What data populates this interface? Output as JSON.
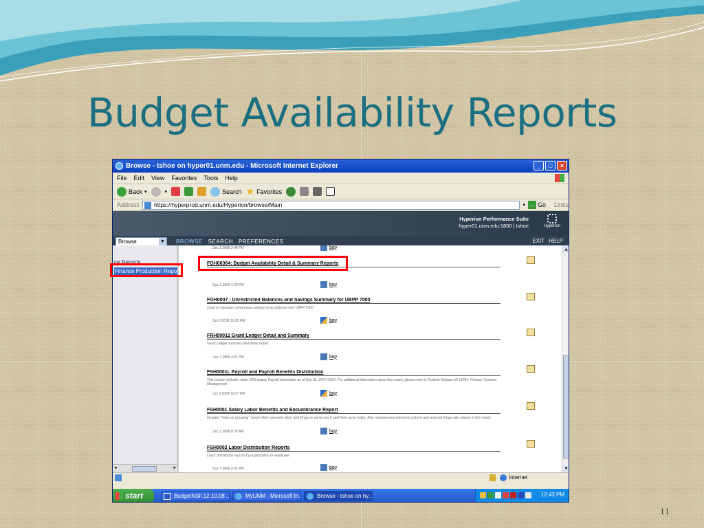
{
  "slide": {
    "title": "Budget Availability Reports",
    "page_number": "11"
  },
  "window": {
    "title": "Browse - tshoe on hyper01.unm.edu - Microsoft Internet Explorer",
    "menu": [
      "File",
      "Edit",
      "View",
      "Favorites",
      "Tools",
      "Help"
    ],
    "toolbar": {
      "back": "Back",
      "search": "Search",
      "favorites": "Favorites"
    },
    "address_label": "Address",
    "address_value": "https://hyperprod.unm.edu/Hyperion/browse/Main",
    "go": "Go",
    "links": "Links"
  },
  "hyperion": {
    "suite_name": "Hyperion Performance Suite",
    "server": "hyper01.unm.edu:1800 | tshoe",
    "logo": "Hyperion",
    "select_value": "Browse",
    "nav": [
      "BROWSE",
      "SEARCH",
      "PREFERENCES"
    ],
    "exit": "EXIT",
    "help": "HELP"
  },
  "left_pane": {
    "partial_item": "ce Reports",
    "selected_item": "Finance Production Repo"
  },
  "reports": [
    {
      "title": "",
      "desc": "",
      "date": "Dec 2 2008  2:48 PM",
      "link": "bqy"
    },
    {
      "title": "FOH00364: Budget Availability Detail & Summary Reports",
      "desc": "",
      "date": "Dec 2 2008  1:20 PM",
      "link": "bqy"
    },
    {
      "title": "FOH0007 - Unrestricted Balances and Savings Summary for UBPP 7000",
      "desc": "Used to measure current year savings in accordance with UBPP 7000",
      "date": "Oct 2 2008  12:25 PM",
      "link": "bqy"
    },
    {
      "title": "FRH00012 Grant Ledger Detail and Summary",
      "desc": "Grant Ledger summary and detail report",
      "date": "Dec 2 2008  2:41 PM",
      "link": "bqy"
    },
    {
      "title": "FSH0001L Payroll and Payroll Benefits Distribution",
      "desc": "This version includes static HRS legacy Payroll information as of Dec 31, 2007 ONLY. For additional information about this report, please refer to FastInfo Release ID 14053 -Finance Systems Management",
      "date": "Oct 3 2008  12:27 PM",
      "link": "bqy"
    },
    {
      "title": "FSH0001 Salary Labor Benefits and Encumbrance Report",
      "desc": "Includes \"index or grouping\" report which presents labor and fringe on same row if paid from same index. Also removed encumbrance column and reduced fringe rate column in this report.",
      "date": "Dec 2 2008  8:32 AM",
      "link": "bqy"
    },
    {
      "title": "FSH0002 Labor Distribution Reports",
      "desc": "Labor distribution reports by organization or employee",
      "date": "Nov 7 2008  2:01 PM",
      "link": "bqy"
    }
  ],
  "status": {
    "zone": "Internet"
  },
  "taskbar": {
    "start": "start",
    "tasks": [
      "BudgetNSF.12.10.08 ...",
      "MyUNM - Microsoft In...",
      "Browse - tshoe on hy..."
    ],
    "clock": "12:43 PM"
  },
  "colors": {
    "title": "#1c6f80",
    "highlight": "#ff0000",
    "taskbar": "#2456c8"
  }
}
